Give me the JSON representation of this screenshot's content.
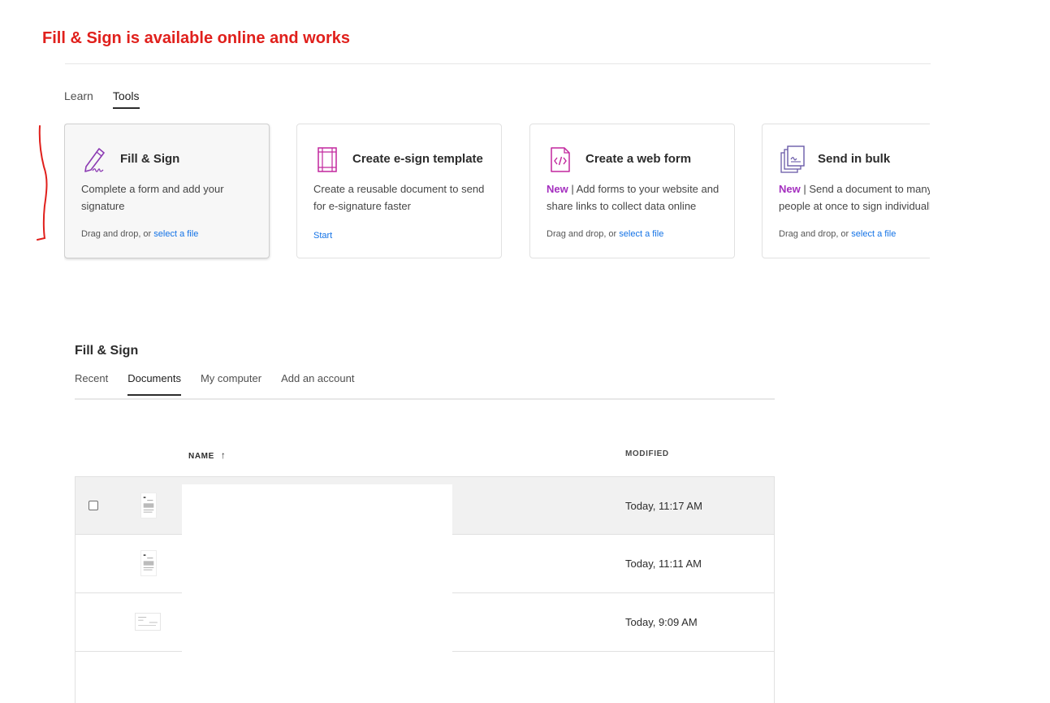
{
  "annotation": {
    "title": "Fill & Sign is available online and works"
  },
  "top_tabs": [
    {
      "label": "Learn",
      "active": false
    },
    {
      "label": "Tools",
      "active": true
    }
  ],
  "cards": [
    {
      "title": "Fill & Sign",
      "icon": "pen-sign-icon",
      "new_badge": "",
      "desc1": "Complete a form and add your",
      "desc2": "signature",
      "foot_text": "Drag and drop, or ",
      "foot_link": "select a file",
      "selected": true
    },
    {
      "title": "Create e-sign template",
      "icon": "template-icon",
      "new_badge": "",
      "desc1": "Create a reusable document to send",
      "desc2": "for e-signature faster",
      "start": "Start"
    },
    {
      "title": "Create a web form",
      "icon": "web-form-icon",
      "new_badge": "New",
      "desc1": " | Add forms to your website and",
      "desc2": "share links to collect data online",
      "foot_text": "Drag and drop, or ",
      "foot_link": "select a file"
    },
    {
      "title": "Send in bulk",
      "icon": "send-bulk-icon",
      "new_badge": "New",
      "desc1": " | Send a document to many",
      "desc2": "people at once to sign individuall",
      "foot_text": "Drag and drop, or ",
      "foot_link": "select a file"
    }
  ],
  "section": {
    "title": "Fill & Sign",
    "tabs": [
      {
        "label": "Recent",
        "active": false
      },
      {
        "label": "Documents",
        "active": true
      },
      {
        "label": "My computer",
        "active": false
      },
      {
        "label": "Add an account",
        "active": false
      }
    ]
  },
  "table": {
    "columns": {
      "name": "NAME",
      "sort_arrow": "↑",
      "modified": "MODIFIED"
    },
    "rows": [
      {
        "modified": "Today, 11:17 AM"
      },
      {
        "modified": "Today, 11:11 AM"
      },
      {
        "modified": "Today, 9:09 AM"
      }
    ]
  },
  "colors": {
    "accent_link": "#1473e6",
    "new_badge": "#a42fbf",
    "annotation_red": "#e0201c",
    "icon_purple": "#8c3bb3",
    "icon_magenta": "#c2279e"
  }
}
